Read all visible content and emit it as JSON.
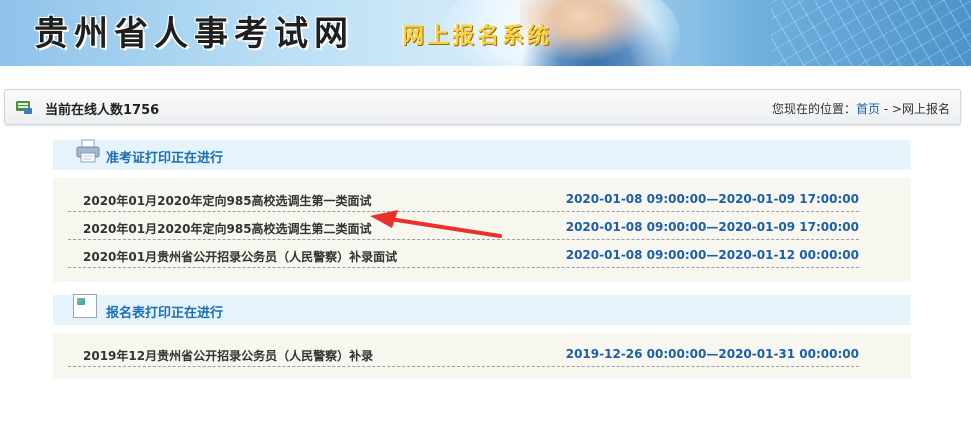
{
  "banner": {
    "title": "贵州省人事考试网",
    "subtitle": "网上报名系统"
  },
  "navbar": {
    "online_label": "当前在线人数1756",
    "location_prefix": "您现在的位置：",
    "home_link": "首页",
    "location_suffix": " - >网上报名"
  },
  "sections": [
    {
      "title": "准考证打印正在进行",
      "items": [
        {
          "name": "2020年01月2020年定向985高校选调生第一类面试",
          "date": "2020-01-08 09:00:00—2020-01-09 17:00:00"
        },
        {
          "name": "2020年01月2020年定向985高校选调生第二类面试",
          "date": "2020-01-08 09:00:00—2020-01-09 17:00:00"
        },
        {
          "name": "2020年01月贵州省公开招录公务员（人民警察）补录面试",
          "date": "2020-01-08 09:00:00—2020-01-12 00:00:00"
        }
      ]
    },
    {
      "title": "报名表打印正在进行",
      "items": [
        {
          "name": "2019年12月贵州省公开招录公务员（人民警察）补录",
          "date": "2019-12-26 00:00:00—2020-01-31 00:00:00"
        }
      ]
    }
  ],
  "colors": {
    "link_blue": "#1a5fa8",
    "section_title": "#1a6fb5",
    "arrow_red": "#e8322b"
  }
}
